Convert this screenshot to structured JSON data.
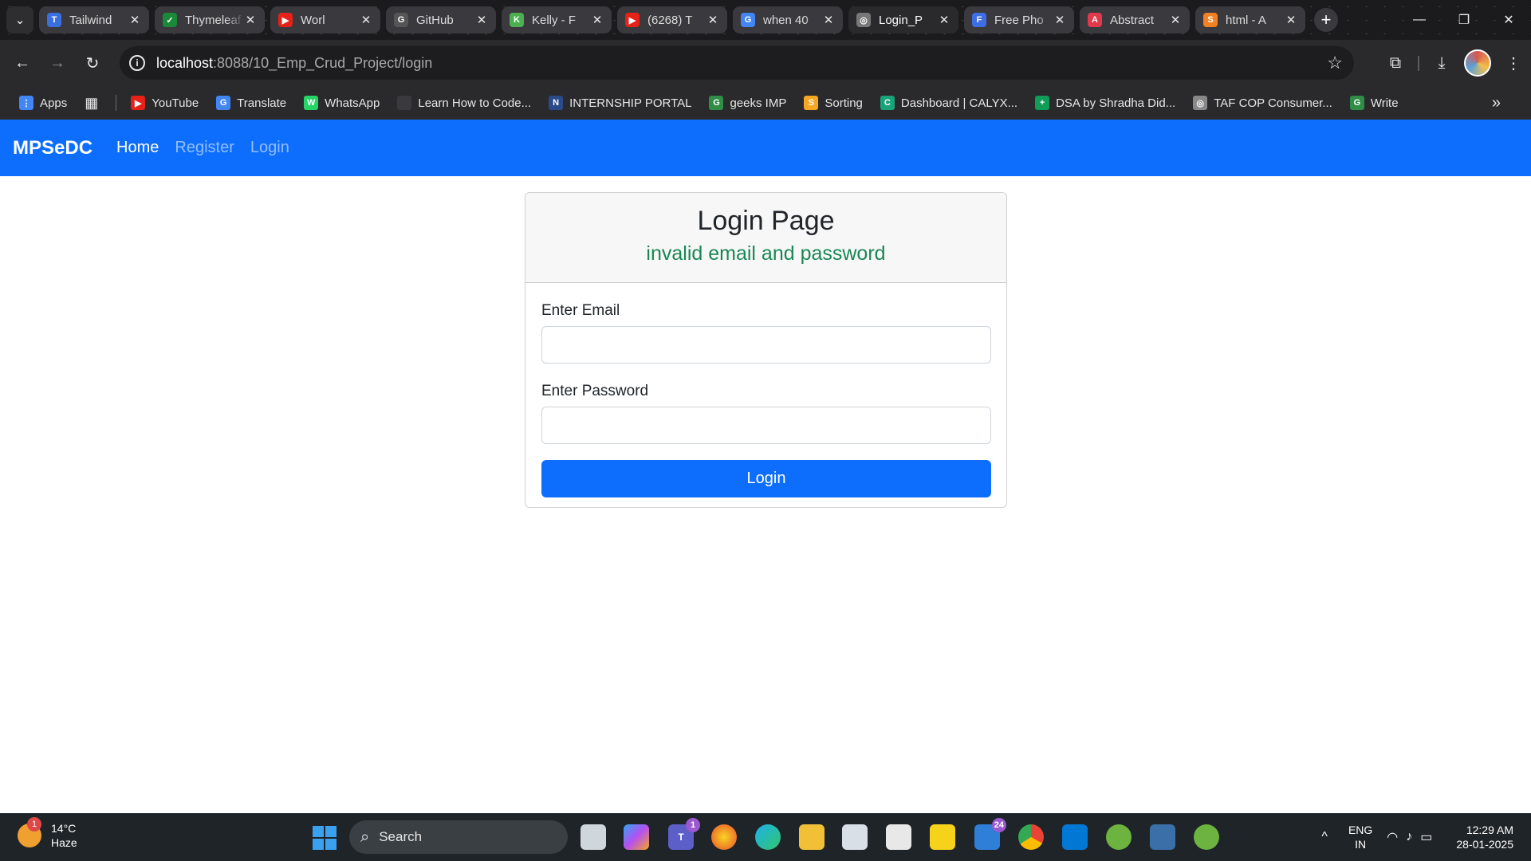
{
  "browser": {
    "tabs": [
      {
        "title": "Tailwind",
        "icon": "tailwind-icon",
        "color": "#3b6fe0",
        "glyph": "T"
      },
      {
        "title": "Thymeleaf",
        "icon": "thymeleaf-icon",
        "color": "#1a8a3a",
        "glyph": "✓"
      },
      {
        "title": "Worl",
        "icon": "youtube-icon",
        "color": "#e62117",
        "glyph": "▶"
      },
      {
        "title": "GitHub",
        "icon": "github-icon",
        "color": "#555555",
        "glyph": "G"
      },
      {
        "title": "Kelly - F",
        "icon": "leaf-icon",
        "color": "#4caf50",
        "glyph": "K"
      },
      {
        "title": "(6268) T",
        "icon": "youtube-icon",
        "color": "#e62117",
        "glyph": "▶"
      },
      {
        "title": "when 40",
        "icon": "google-icon",
        "color": "#4285f4",
        "glyph": "G"
      },
      {
        "title": "Login_P",
        "icon": "globe-icon",
        "color": "#777777",
        "glyph": "◎",
        "active": true
      },
      {
        "title": "Free Pho",
        "icon": "freepik-icon",
        "color": "#3f6de6",
        "glyph": "F"
      },
      {
        "title": "Abstract",
        "icon": "app-icon",
        "color": "#e0394b",
        "glyph": "A"
      },
      {
        "title": "html - A",
        "icon": "stackoverflow-icon",
        "color": "#f48024",
        "glyph": "S"
      }
    ],
    "url_host": "localhost",
    "url_path": ":8088/10_Emp_Crud_Project/login",
    "bookmarks": [
      {
        "label": "Apps",
        "icon": "apps-grid-icon",
        "color": "#4285f4",
        "glyph": "⋮"
      },
      {
        "label": "YouTube",
        "icon": "youtube-icon",
        "color": "#e62117",
        "glyph": "▶"
      },
      {
        "label": "Translate",
        "icon": "translate-icon",
        "color": "#4285f4",
        "glyph": "G"
      },
      {
        "label": "WhatsApp",
        "icon": "whatsapp-icon",
        "color": "#25d366",
        "glyph": "W"
      },
      {
        "label": "Learn How to Code...",
        "icon": "page-icon",
        "color": "#3a3a3e",
        "glyph": ""
      },
      {
        "label": "INTERNSHIP PORTAL",
        "icon": "portal-icon",
        "color": "#2a4a8a",
        "glyph": "N"
      },
      {
        "label": "geeks IMP",
        "icon": "gfg-icon",
        "color": "#2f8d46",
        "glyph": "G"
      },
      {
        "label": "Sorting",
        "icon": "sorting-icon",
        "color": "#f5a623",
        "glyph": "S"
      },
      {
        "label": "Dashboard | CALYX...",
        "icon": "calyx-icon",
        "color": "#1aa37a",
        "glyph": "C"
      },
      {
        "label": "DSA by Shradha Did...",
        "icon": "sheets-icon",
        "color": "#0f9d58",
        "glyph": "+"
      },
      {
        "label": "TAF COP Consumer...",
        "icon": "globe-icon",
        "color": "#888888",
        "glyph": "◎"
      },
      {
        "label": "Write",
        "icon": "gfg-icon",
        "color": "#2f8d46",
        "glyph": "G"
      }
    ]
  },
  "navbar": {
    "brand": "MPSeDC",
    "links": [
      {
        "label": "Home",
        "active": true
      },
      {
        "label": "Register",
        "active": false
      },
      {
        "label": "Login",
        "active": false
      }
    ]
  },
  "login": {
    "title": "Login Page",
    "message": "invalid email and password",
    "email_label": "Enter Email",
    "email_value": "",
    "password_label": "Enter Password",
    "password_value": "",
    "button_label": "Login"
  },
  "taskbar": {
    "weather_temp": "14°C",
    "weather_desc": "Haze",
    "weather_badge": "1",
    "search_label": "Search",
    "teams_badge": "1",
    "mail_badge": "24",
    "lang_line1": "ENG",
    "lang_line2": "IN",
    "time": "12:29 AM",
    "date": "28-01-2025"
  },
  "colors": {
    "primary": "#0d6efd",
    "success": "#198754"
  }
}
